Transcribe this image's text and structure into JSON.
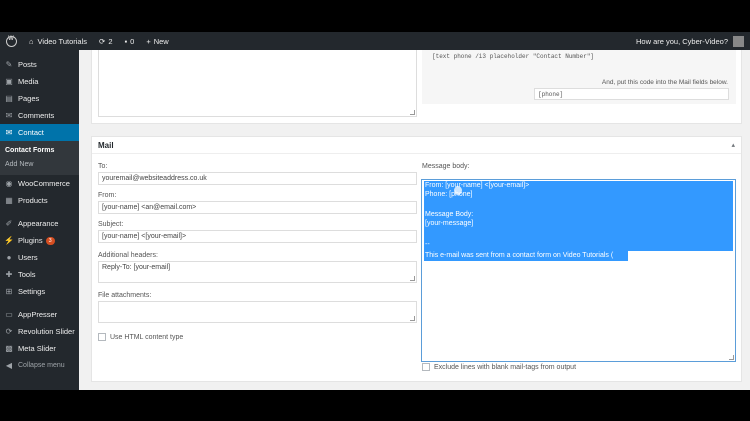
{
  "topbar": {
    "site_name": "Video Tutorials",
    "updates_count": "2",
    "comments_count": "0",
    "new_label": "New",
    "greeting": "How are you, Cyber-Video?"
  },
  "sidebar": {
    "items": [
      {
        "label": "Posts",
        "icon": "pin-icon"
      },
      {
        "label": "Media",
        "icon": "media-icon"
      },
      {
        "label": "Pages",
        "icon": "page-icon"
      },
      {
        "label": "Comments",
        "icon": "comment-icon"
      },
      {
        "label": "Contact",
        "icon": "mail-icon"
      },
      {
        "label": "WooCommerce",
        "icon": "woo-icon"
      },
      {
        "label": "Products",
        "icon": "products-icon"
      },
      {
        "label": "Appearance",
        "icon": "brush-icon"
      },
      {
        "label": "Plugins",
        "icon": "plug-icon",
        "badge": "3"
      },
      {
        "label": "Users",
        "icon": "user-icon"
      },
      {
        "label": "Tools",
        "icon": "wrench-icon"
      },
      {
        "label": "Settings",
        "icon": "settings-icon"
      },
      {
        "label": "AppPresser",
        "icon": "app-icon"
      },
      {
        "label": "Revolution Slider",
        "icon": "refresh-icon"
      },
      {
        "label": "Meta Slider",
        "icon": "slider-icon"
      },
      {
        "label": "Collapse menu",
        "icon": "collapse-icon"
      }
    ],
    "contact_sub": [
      "Contact Forms",
      "Add New"
    ]
  },
  "top_panel": {
    "tag_code": "[text phone /i3 placeholder \"Contact Number\"]",
    "help_text": "And, put this code into the Mail fields below.",
    "mail_tag": "[phone]"
  },
  "mail": {
    "title": "Mail",
    "to_label": "To:",
    "to_value": "youremail@websiteaddress.co.uk",
    "from_label": "From:",
    "from_value": "[your-name] <an@email.com>",
    "subject_label": "Subject:",
    "subject_value": " [your-name] <[your-email]>",
    "headers_label": "Additional headers:",
    "headers_value": "Reply-To: [your-email]",
    "attachments_label": "File attachments:",
    "html_label": "Use HTML content type",
    "body_label": "Message body:",
    "body_lines": [
      "From: [your-name] <[your-email]>",
      "Phone: [phone]",
      "",
      "Message Body:",
      "[your-message]",
      "",
      "--",
      "This e-mail was sent from a contact form on Video Tutorials ("
    ],
    "exclude_label": "Exclude lines with blank mail-tags from output"
  }
}
